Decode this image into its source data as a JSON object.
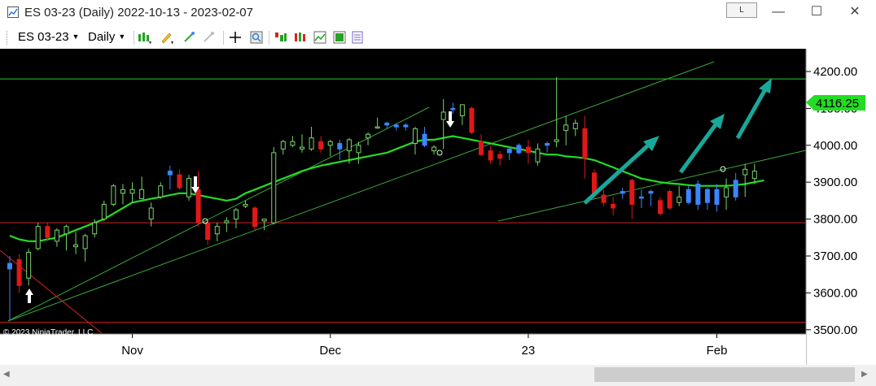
{
  "window": {
    "title": "ES 03-23 (Daily)  2022-10-13 - 2023-02-07",
    "layout_button": "L",
    "minimize": "—",
    "maximize": "☐",
    "close": "✕"
  },
  "toolbar": {
    "instrument": "ES 03-23",
    "interval": "Daily"
  },
  "chart": {
    "copyright": "© 2023 NinjaTrader, LLC",
    "current_price_label": "4116.25",
    "y_ticks": [
      "4200.00",
      "4100.00",
      "4000.00",
      "3900.00",
      "3800.00",
      "3700.00",
      "3600.00",
      "3500.00"
    ],
    "x_ticks": [
      "Nov",
      "Dec",
      "23",
      "Feb"
    ],
    "colors": {
      "background": "#000000",
      "up_candle": "#7ad46a",
      "down_candle": "#e01818",
      "neutral_candle": "#3a86ff",
      "moving_average": "#22dd22",
      "trendline": "#3aa83a",
      "horizontal_line_red": "#d22222",
      "horizontal_line_green": "#2ccc2c",
      "arrow": "#17a89a"
    }
  },
  "scrollbar": {
    "left_arrow": "◀",
    "right_arrow": "▶"
  },
  "chart_data": {
    "type": "candlestick",
    "x_range": [
      "2022-10-13",
      "2023-02-07"
    ],
    "ylim": [
      3490,
      4225
    ],
    "current_price": 4116.25,
    "candles": [
      {
        "date": "2022-10-13",
        "o": 3665,
        "h": 3700,
        "l": 3525,
        "c": 3680,
        "color": "neutral"
      },
      {
        "date": "2022-10-14",
        "o": 3690,
        "h": 3705,
        "l": 3600,
        "c": 3620,
        "color": "down"
      },
      {
        "date": "2022-10-17",
        "o": 3640,
        "h": 3720,
        "l": 3620,
        "c": 3710,
        "color": "up"
      },
      {
        "date": "2022-10-18",
        "o": 3720,
        "h": 3790,
        "l": 3715,
        "c": 3780,
        "color": "up"
      },
      {
        "date": "2022-10-19",
        "o": 3780,
        "h": 3790,
        "l": 3740,
        "c": 3750,
        "color": "down"
      },
      {
        "date": "2022-10-20",
        "o": 3740,
        "h": 3775,
        "l": 3725,
        "c": 3770,
        "color": "up"
      },
      {
        "date": "2022-10-21",
        "o": 3760,
        "h": 3785,
        "l": 3715,
        "c": 3780,
        "color": "up"
      },
      {
        "date": "2022-10-24",
        "o": 3730,
        "h": 3765,
        "l": 3705,
        "c": 3725,
        "color": "up"
      },
      {
        "date": "2022-10-25",
        "o": 3720,
        "h": 3760,
        "l": 3685,
        "c": 3755,
        "color": "up"
      },
      {
        "date": "2022-10-26",
        "o": 3760,
        "h": 3800,
        "l": 3750,
        "c": 3790,
        "color": "up"
      },
      {
        "date": "2022-10-27",
        "o": 3800,
        "h": 3850,
        "l": 3795,
        "c": 3840,
        "color": "up"
      },
      {
        "date": "2022-10-28",
        "o": 3840,
        "h": 3895,
        "l": 3835,
        "c": 3890,
        "color": "up"
      },
      {
        "date": "2022-10-31",
        "o": 3880,
        "h": 3895,
        "l": 3840,
        "c": 3870,
        "color": "up"
      },
      {
        "date": "2022-11-01",
        "o": 3880,
        "h": 3900,
        "l": 3845,
        "c": 3870,
        "color": "up"
      },
      {
        "date": "2022-11-02",
        "o": 3880,
        "h": 3915,
        "l": 3860,
        "c": 3855,
        "color": "up"
      },
      {
        "date": "2022-11-03",
        "o": 3800,
        "h": 3845,
        "l": 3780,
        "c": 3830,
        "color": "up"
      },
      {
        "date": "2022-11-04",
        "o": 3860,
        "h": 3900,
        "l": 3855,
        "c": 3890,
        "color": "up"
      },
      {
        "date": "2022-11-07",
        "o": 3930,
        "h": 3945,
        "l": 3880,
        "c": 3920,
        "color": "neutral"
      },
      {
        "date": "2022-11-08",
        "o": 3920,
        "h": 3935,
        "l": 3880,
        "c": 3885,
        "color": "down"
      },
      {
        "date": "2022-11-09",
        "o": 3860,
        "h": 3920,
        "l": 3850,
        "c": 3910,
        "color": "up"
      },
      {
        "date": "2022-11-10",
        "o": 3880,
        "h": 3930,
        "l": 3780,
        "c": 3790,
        "color": "down"
      },
      {
        "date": "2022-11-11",
        "o": 3790,
        "h": 3800,
        "l": 3730,
        "c": 3745,
        "color": "down"
      },
      {
        "date": "2022-11-14",
        "o": 3760,
        "h": 3790,
        "l": 3740,
        "c": 3780,
        "color": "up"
      },
      {
        "date": "2022-11-15",
        "o": 3795,
        "h": 3805,
        "l": 3765,
        "c": 3790,
        "color": "up"
      },
      {
        "date": "2022-11-16",
        "o": 3800,
        "h": 3830,
        "l": 3775,
        "c": 3825,
        "color": "up"
      },
      {
        "date": "2022-11-17",
        "o": 3835,
        "h": 3850,
        "l": 3830,
        "c": 3840,
        "color": "up"
      },
      {
        "date": "2022-11-18",
        "o": 3830,
        "h": 3835,
        "l": 3770,
        "c": 3780,
        "color": "down"
      },
      {
        "date": "2022-11-21",
        "o": 3800,
        "h": 3800,
        "l": 3770,
        "c": 3795,
        "color": "up"
      },
      {
        "date": "2022-11-22",
        "o": 3790,
        "h": 3995,
        "l": 3785,
        "c": 3980,
        "color": "up"
      },
      {
        "date": "2022-11-23",
        "o": 3990,
        "h": 4015,
        "l": 3975,
        "c": 4010,
        "color": "up"
      },
      {
        "date": "2022-11-25",
        "o": 4010,
        "h": 4025,
        "l": 3995,
        "c": 4000,
        "color": "up"
      },
      {
        "date": "2022-11-28",
        "o": 3995,
        "h": 4030,
        "l": 3980,
        "c": 3990,
        "color": "up"
      },
      {
        "date": "2022-11-29",
        "o": 3990,
        "h": 4050,
        "l": 3985,
        "c": 4020,
        "color": "up"
      },
      {
        "date": "2022-11-30",
        "o": 4010,
        "h": 4025,
        "l": 3980,
        "c": 3990,
        "color": "down"
      },
      {
        "date": "2022-12-01",
        "o": 4000,
        "h": 4015,
        "l": 3970,
        "c": 4010,
        "color": "up"
      },
      {
        "date": "2022-12-02",
        "o": 3990,
        "h": 4015,
        "l": 3960,
        "c": 4005,
        "color": "neutral"
      },
      {
        "date": "2022-12-05",
        "o": 3985,
        "h": 4020,
        "l": 3950,
        "c": 4015,
        "color": "up"
      },
      {
        "date": "2022-12-06",
        "o": 3980,
        "h": 4010,
        "l": 3950,
        "c": 4000,
        "color": "up"
      },
      {
        "date": "2022-12-07",
        "o": 4020,
        "h": 4035,
        "l": 4000,
        "c": 4030,
        "color": "up"
      },
      {
        "date": "2022-12-08",
        "o": 4050,
        "h": 4075,
        "l": 4045,
        "c": 4050,
        "color": "up"
      },
      {
        "date": "2022-12-09",
        "o": 4055,
        "h": 4065,
        "l": 4045,
        "c": 4060,
        "color": "neutral"
      },
      {
        "date": "2022-12-12",
        "o": 4050,
        "h": 4060,
        "l": 4040,
        "c": 4055,
        "color": "neutral"
      },
      {
        "date": "2022-12-13",
        "o": 4050,
        "h": 4060,
        "l": 4040,
        "c": 4055,
        "color": "neutral"
      },
      {
        "date": "2022-12-14",
        "o": 4005,
        "h": 4050,
        "l": 3975,
        "c": 4045,
        "color": "up"
      },
      {
        "date": "2022-12-15",
        "o": 4030,
        "h": 4050,
        "l": 3995,
        "c": 4000,
        "color": "neutral"
      },
      {
        "date": "2022-12-16",
        "o": 3985,
        "h": 4000,
        "l": 3975,
        "c": 3995,
        "color": "up"
      },
      {
        "date": "2022-12-19",
        "o": 4070,
        "h": 4125,
        "l": 3990,
        "c": 4090,
        "color": "up"
      },
      {
        "date": "2022-12-20",
        "o": 4100,
        "h": 4115,
        "l": 4085,
        "c": 4100,
        "color": "neutral"
      },
      {
        "date": "2022-12-21",
        "o": 4080,
        "h": 4110,
        "l": 4055,
        "c": 4110,
        "color": "up"
      },
      {
        "date": "2022-12-22",
        "o": 4100,
        "h": 4105,
        "l": 4030,
        "c": 4035,
        "color": "down"
      },
      {
        "date": "2022-12-23",
        "o": 4010,
        "h": 4030,
        "l": 3970,
        "c": 3975,
        "color": "down"
      },
      {
        "date": "2022-12-27",
        "o": 3985,
        "h": 4000,
        "l": 3950,
        "c": 3960,
        "color": "down"
      },
      {
        "date": "2022-12-28",
        "o": 3975,
        "h": 3985,
        "l": 3945,
        "c": 3965,
        "color": "down"
      },
      {
        "date": "2022-12-29",
        "o": 3980,
        "h": 3995,
        "l": 3960,
        "c": 3990,
        "color": "neutral"
      },
      {
        "date": "2022-12-30",
        "o": 4000,
        "h": 4005,
        "l": 3975,
        "c": 3980,
        "color": "neutral"
      },
      {
        "date": "2023-01-03",
        "o": 3995,
        "h": 4015,
        "l": 3950,
        "c": 3980,
        "color": "down"
      },
      {
        "date": "2023-01-04",
        "o": 3955,
        "h": 4005,
        "l": 3945,
        "c": 3990,
        "color": "up"
      },
      {
        "date": "2023-01-05",
        "o": 4005,
        "h": 4010,
        "l": 3980,
        "c": 4000,
        "color": "neutral"
      },
      {
        "date": "2023-01-06",
        "o": 4010,
        "h": 4185,
        "l": 3995,
        "c": 4015,
        "color": "up"
      },
      {
        "date": "2023-01-09",
        "o": 4040,
        "h": 4080,
        "l": 4000,
        "c": 4055,
        "color": "up"
      },
      {
        "date": "2023-01-10",
        "o": 4060,
        "h": 4070,
        "l": 4025,
        "c": 4045,
        "color": "up"
      },
      {
        "date": "2023-01-11",
        "o": 4045,
        "h": 4080,
        "l": 3910,
        "c": 3965,
        "color": "down"
      },
      {
        "date": "2023-01-12",
        "o": 3925,
        "h": 3935,
        "l": 3855,
        "c": 3870,
        "color": "down"
      },
      {
        "date": "2023-01-13",
        "o": 3865,
        "h": 3880,
        "l": 3835,
        "c": 3845,
        "color": "down"
      },
      {
        "date": "2023-01-17",
        "o": 3840,
        "h": 3860,
        "l": 3810,
        "c": 3830,
        "color": "down"
      },
      {
        "date": "2023-01-18",
        "o": 3875,
        "h": 3885,
        "l": 3855,
        "c": 3870,
        "color": "neutral"
      },
      {
        "date": "2023-01-19",
        "o": 3905,
        "h": 3910,
        "l": 3800,
        "c": 3840,
        "color": "down"
      },
      {
        "date": "2023-01-20",
        "o": 3860,
        "h": 3880,
        "l": 3830,
        "c": 3860,
        "color": "neutral"
      },
      {
        "date": "2023-01-23",
        "o": 3870,
        "h": 3880,
        "l": 3835,
        "c": 3875,
        "color": "neutral"
      },
      {
        "date": "2023-01-24",
        "o": 3850,
        "h": 3860,
        "l": 3810,
        "c": 3815,
        "color": "down"
      },
      {
        "date": "2023-01-25",
        "o": 3875,
        "h": 3880,
        "l": 3825,
        "c": 3830,
        "color": "down"
      },
      {
        "date": "2023-01-26",
        "o": 3845,
        "h": 3890,
        "l": 3835,
        "c": 3860,
        "color": "up"
      },
      {
        "date": "2023-01-27",
        "o": 3880,
        "h": 3890,
        "l": 3840,
        "c": 3845,
        "color": "neutral"
      },
      {
        "date": "2023-01-30",
        "o": 3895,
        "h": 3905,
        "l": 3825,
        "c": 3840,
        "color": "neutral"
      },
      {
        "date": "2023-01-31",
        "o": 3845,
        "h": 3885,
        "l": 3825,
        "c": 3880,
        "color": "neutral"
      },
      {
        "date": "2023-02-01",
        "o": 3880,
        "h": 3895,
        "l": 3820,
        "c": 3840,
        "color": "neutral"
      },
      {
        "date": "2023-02-02",
        "o": 3885,
        "h": 3910,
        "l": 3825,
        "c": 3860,
        "color": "up"
      },
      {
        "date": "2023-02-03",
        "o": 3860,
        "h": 3925,
        "l": 3850,
        "c": 3905,
        "color": "neutral"
      },
      {
        "date": "2023-02-06",
        "o": 3920,
        "h": 3950,
        "l": 3860,
        "c": 3935,
        "color": "up"
      },
      {
        "date": "2023-02-07",
        "o": 3910,
        "h": 3950,
        "l": 3895,
        "c": 3930,
        "color": "up"
      }
    ],
    "moving_average": [
      3755,
      3745,
      3740,
      3740,
      3745,
      3750,
      3760,
      3770,
      3780,
      3790,
      3800,
      3815,
      3830,
      3845,
      3850,
      3855,
      3860,
      3865,
      3870,
      3870,
      3865,
      3860,
      3855,
      3850,
      3855,
      3870,
      3880,
      3890,
      3900,
      3910,
      3920,
      3930,
      3938,
      3945,
      3950,
      3955,
      3960,
      3965,
      3970,
      3975,
      3980,
      3990,
      4000,
      4010,
      4015,
      4015,
      4020,
      4025,
      4020,
      4015,
      4010,
      4005,
      4000,
      3995,
      3990,
      3985,
      3980,
      3975,
      3975,
      3970,
      3968,
      3965,
      3960,
      3950,
      3940,
      3930,
      3920,
      3910,
      3905,
      3900,
      3897,
      3895,
      3892,
      3890,
      3890,
      3890,
      3890,
      3892,
      3895,
      3900,
      3905
    ],
    "horizontal_lines": [
      {
        "price": 4180,
        "color": "green"
      },
      {
        "price": 3790,
        "color": "red"
      },
      {
        "price": 3520,
        "color": "red"
      }
    ]
  }
}
